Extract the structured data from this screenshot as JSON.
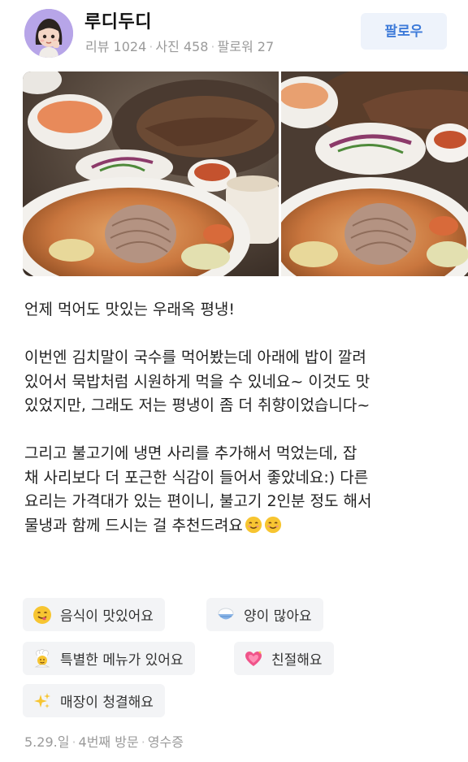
{
  "profile": {
    "name": "루디두디",
    "stats": [
      "리뷰 1024",
      "사진 458",
      "팔로워 27"
    ],
    "follow_label": "팔로우"
  },
  "photos": [
    {
      "icon": "food-photo-naengmyeon-1"
    },
    {
      "icon": "food-photo-naengmyeon-2"
    }
  ],
  "review": {
    "paragraphs": [
      "언제 먹어도 맛있는 우래옥 평냉!",
      "이번엔 김치말이 국수를 먹어봤는데 아래에 밥이 깔려 있어서 묵밥처럼 시원하게 먹을 수 있네요~ 이것도 맛 있었지만, 그래도 저는 평냉이 좀 더 취향이었습니다~",
      "그리고 불고기에 냉면 사리를 추가해서 먹었는데, 잡채 사리보다 더 포근한 식감이 들어서 좋았네요:) 다른 요리는 가격대가 있는 편이니, 불고기 2인분 정도 해서 물냉과 함께 드시는 걸 추천드려요"
    ],
    "lines": [
      "언제 먹어도 맛있는 우래옥 평냉!",
      "",
      "이번엔 김치말이 국수를 먹어봤는데 아래에 밥이 깔려",
      "있어서 묵밥처럼 시원하게 먹을 수 있네요~ 이것도 맛",
      "있었지만, 그래도 저는 평냉이 좀 더 취향이었습니다~",
      "",
      "그리고 불고기에 냉면 사리를 추가해서 먹었는데, 잡",
      "채 사리보다 더 포근한 식감이 들어서 좋았네요:) 다른",
      "요리는 가격대가 있는 편이니, 불고기 2인분 정도 해서",
      "물냉과 함께 드시는 걸 추천드려요"
    ],
    "trailing_emoji": [
      "smiling-face-icon",
      "smiling-face-icon"
    ]
  },
  "tags": [
    {
      "label": "음식이 맛있어요",
      "icon": "yum-face-icon"
    },
    {
      "label": "양이 많아요",
      "icon": "rice-bowl-icon"
    },
    {
      "label": "특별한 메뉴가 있어요",
      "icon": "chef-icon"
    },
    {
      "label": "친절해요",
      "icon": "sparkling-heart-icon"
    },
    {
      "label": "매장이 청결해요",
      "icon": "sparkles-icon"
    }
  ],
  "footer": {
    "date": "5.29.일",
    "visit": "4번째 방문",
    "verify": "영수증"
  },
  "colors": {
    "follow_bg": "#eef3fb",
    "follow_text": "#3e7bd9",
    "tag_bg": "#f3f4f6",
    "meta_text": "#9a9a9a"
  }
}
